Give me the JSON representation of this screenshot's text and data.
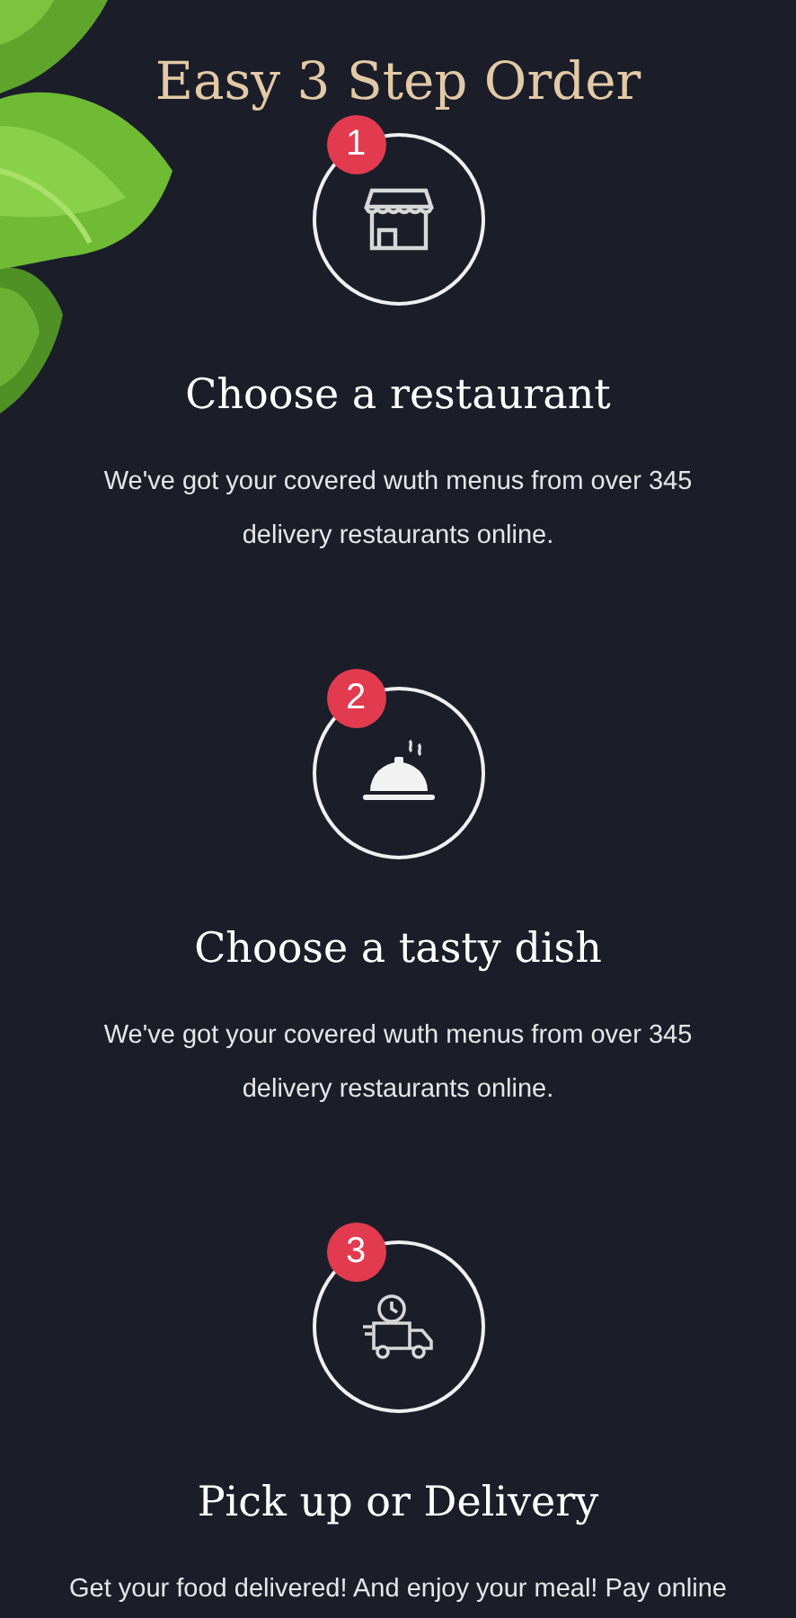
{
  "title": "Easy 3 Step Order",
  "steps": [
    {
      "number": "1",
      "kind": "store",
      "heading": "Choose a restaurant",
      "text": "We've got your covered wuth menus from over 345 delivery restaurants online."
    },
    {
      "number": "2",
      "kind": "cloche",
      "heading": "Choose a tasty dish",
      "text": "We've got your covered wuth menus from over 345 delivery restaurants online."
    },
    {
      "number": "3",
      "kind": "truck",
      "heading": "Pick up or Delivery",
      "text": "Get your food delivered! And enjoy your meal! Pay online"
    }
  ]
}
